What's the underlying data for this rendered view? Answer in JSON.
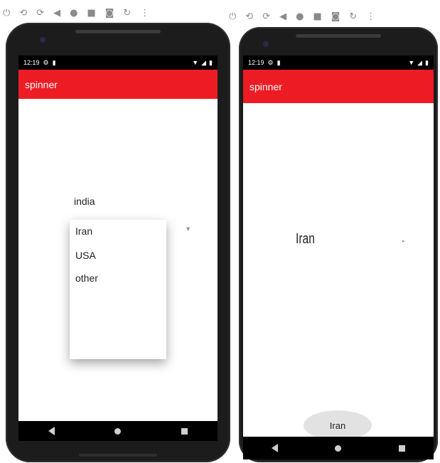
{
  "toolbar_icons": [
    "power-icon",
    "rotate-left-icon",
    "rotate-right-icon",
    "back-icon",
    "home-icon",
    "overview-icon",
    "camera-icon",
    "replay-icon",
    "more-icon"
  ],
  "left": {
    "status": {
      "time": "12:19"
    },
    "app_title": "spinner",
    "spinner_options": [
      "india",
      "Iran",
      "USA",
      "other"
    ]
  },
  "right": {
    "status": {
      "time": "12:19"
    },
    "app_title": "spinner",
    "selected_value": "Iran",
    "button_label": "Iran"
  }
}
